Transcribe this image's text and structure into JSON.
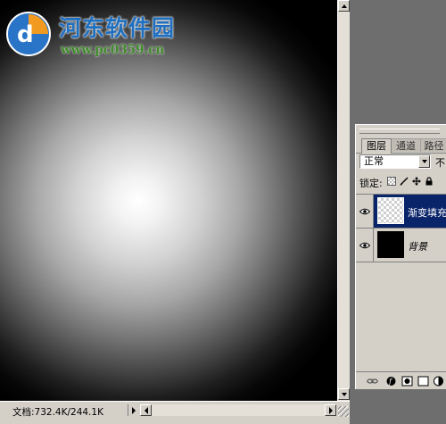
{
  "watermark": {
    "title": "河东软件园",
    "url": "www.pc0359.cn"
  },
  "statusbar": {
    "doc_info": "文档:732.4K/244.1K"
  },
  "layers_panel": {
    "tabs": [
      {
        "label": "图层",
        "active": true
      },
      {
        "label": "通道",
        "active": false
      },
      {
        "label": "路径",
        "active": false
      }
    ],
    "blend_mode": "正常",
    "opacity_label": "不",
    "lock_label": "锁定:",
    "layers": [
      {
        "name": "渐变填充",
        "selected": true,
        "visible": true
      },
      {
        "name": "背景",
        "selected": false,
        "visible": true
      }
    ]
  },
  "colors": {
    "selection": "#0a246a",
    "panel": "#d4d0c8",
    "workspace": "#6e6e6e",
    "watermark_blue": "#1f6fc0",
    "watermark_green": "#3f8a2a"
  }
}
